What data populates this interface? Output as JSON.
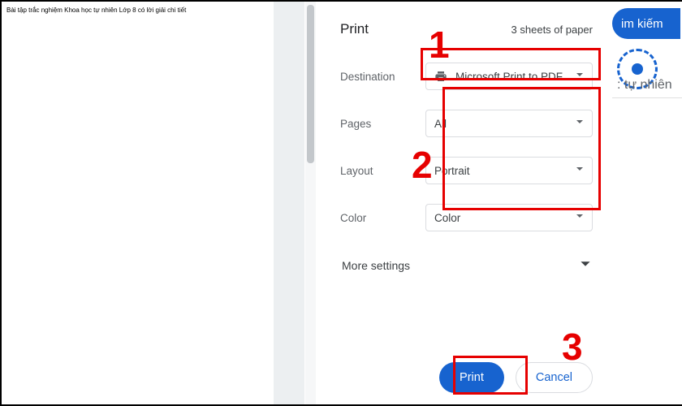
{
  "preview": {
    "doc_title": "Bài tập trắc nghiệm Khoa học tự nhiên Lớp 8 có lời giải chi tiết"
  },
  "panel": {
    "title": "Print",
    "sheets": "3 sheets of paper",
    "labels": {
      "destination": "Destination",
      "pages": "Pages",
      "layout": "Layout",
      "color": "Color"
    },
    "fields": {
      "destination": "Microsoft Print to PDF",
      "pages": "All",
      "layout": "Portrait",
      "color": "Color"
    },
    "more_settings": "More settings",
    "buttons": {
      "print": "Print",
      "cancel": "Cancel"
    }
  },
  "rslice": {
    "search_label": "im kiếm",
    "tag_label": ": tự nhiên"
  },
  "annotations": {
    "n1": "1",
    "n2": "2",
    "n3": "3"
  }
}
